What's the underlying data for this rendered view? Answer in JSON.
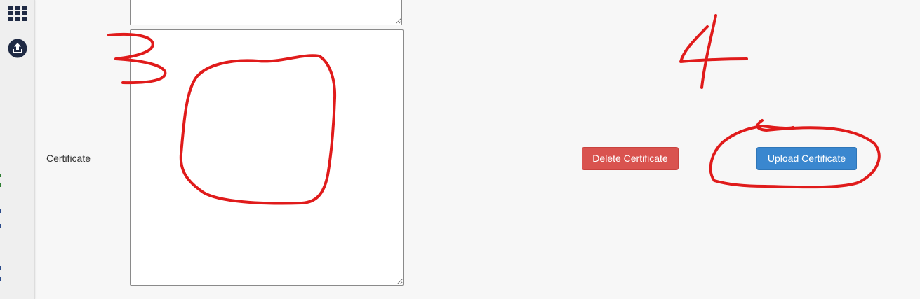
{
  "sidebar": {
    "icons": [
      {
        "name": "apps-grid-icon"
      },
      {
        "name": "upload-icon"
      }
    ]
  },
  "form": {
    "certificate_label": "Certificate",
    "top_textarea_value": "",
    "certificate_textarea_value": ""
  },
  "actions": {
    "delete_label": "Delete Certificate",
    "upload_label": "Upload Certificate"
  },
  "colors": {
    "delete": "#d9534f",
    "upload": "#3a87cf",
    "annotation": "#e01b1b",
    "sidebar_icon": "#1f2a44"
  }
}
